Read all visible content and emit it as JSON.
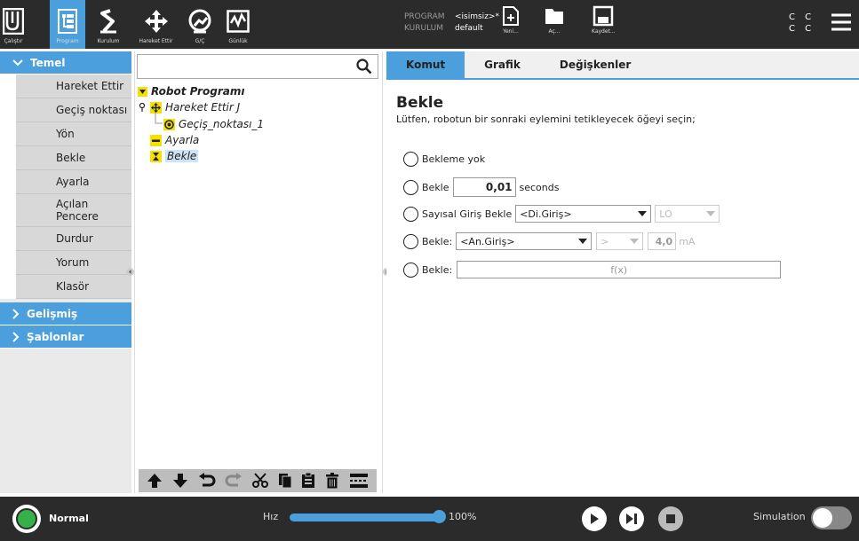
{
  "top_nav": {
    "items": [
      {
        "label": "Çalıştır",
        "icon": "ur-logo-icon"
      },
      {
        "label": "Program",
        "icon": "program-icon"
      },
      {
        "label": "Kurulum",
        "icon": "robot-arm-icon"
      },
      {
        "label": "Hareket Ettir",
        "icon": "move-icon"
      },
      {
        "label": "G/Ç",
        "icon": "io-icon"
      },
      {
        "label": "Günlük",
        "icon": "log-icon"
      }
    ],
    "active": "Program"
  },
  "program_info": {
    "program_key": "PROGRAM",
    "program_value": "<isimsiz>*",
    "installation_key": "KURULUM",
    "installation_value": "default"
  },
  "file_buttons": {
    "new": "Yeni...",
    "open": "Aç...",
    "save": "Kaydet..."
  },
  "header_right": {
    "cc_line1": "C C",
    "cc_line2": "C C"
  },
  "sidebar": {
    "basic_label": "Temel",
    "items": [
      "Hareket Ettir",
      "Geçiş noktası",
      "Yön",
      "Bekle",
      "Ayarla",
      "Açılan Pencere",
      "Durdur",
      "Yorum",
      "Klasör"
    ],
    "advanced_label": "Gelişmiş",
    "templates_label": "Şablonlar"
  },
  "tree": {
    "search_placeholder": "",
    "root": "Robot Programı",
    "move": "Hareket Ettir J",
    "waypoint": "Geçiş_noktası_1",
    "set": "Ayarla",
    "wait": "Bekle"
  },
  "tabs": [
    "Komut",
    "Grafik",
    "Değişkenler"
  ],
  "command": {
    "title": "Bekle",
    "description": "Lütfen, robotun bir sonraki eylemini tetikleyecek öğeyi seçin;",
    "opt_no_wait": "Bekleme yok",
    "opt_wait": "Bekle",
    "wait_value": "0,01",
    "wait_unit": "seconds",
    "opt_digital": "Sayısal Giriş Bekle",
    "digital_select": "<Di.Giriş>",
    "digital_state": "LO",
    "opt_analog": "Bekle:",
    "analog_select": "<An.Giriş>",
    "analog_op": ">",
    "analog_value": "4,0",
    "analog_unit": "mA",
    "opt_expr": "Bekle:",
    "expr_value": "f(x)"
  },
  "bottom": {
    "status": "Normal",
    "speed_label": "Hız",
    "speed_value": "100%",
    "speed_fraction": 1.0,
    "simulation_label": "Simulation"
  },
  "colors": {
    "accent": "#4a9fdc",
    "bar_bg": "#2b2b2b",
    "status_ok": "#35b14a"
  }
}
